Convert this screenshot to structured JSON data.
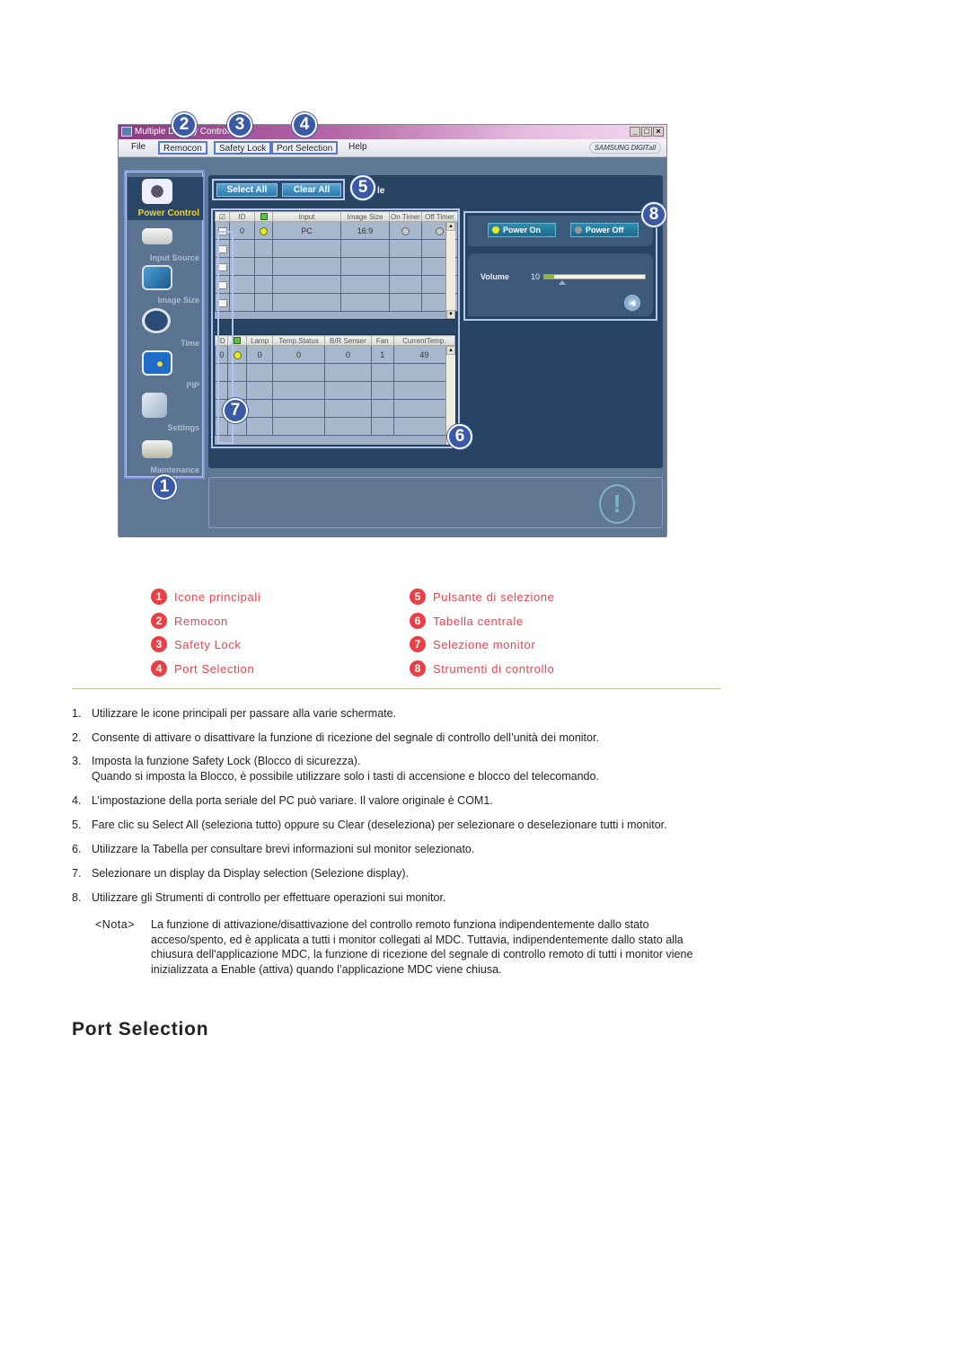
{
  "app": {
    "window_title": "Multiple Display Control",
    "window_buttons": [
      "_",
      "□",
      "×"
    ],
    "menu": [
      "File",
      "Remocon",
      "Safety Lock",
      "Port Selection",
      "Help"
    ],
    "brand": "SAMSUNG DIGITall",
    "sidebar": [
      {
        "label": "Power Control",
        "icon": "power-control-icon",
        "active": true
      },
      {
        "label": "Input Source",
        "icon": "input-source-icon",
        "active": false
      },
      {
        "label": "Image Size",
        "icon": "image-size-icon",
        "active": false
      },
      {
        "label": "Time",
        "icon": "clock-icon",
        "active": false
      },
      {
        "label": "PIP",
        "icon": "pip-icon",
        "active": false
      },
      {
        "label": "Settings",
        "icon": "settings-icon",
        "active": false
      },
      {
        "label": "Maintenance",
        "icon": "maintenance-icon",
        "active": false
      }
    ],
    "select_all": "Select All",
    "clear_all": "Clear All",
    "peek_text": "le",
    "top_table": {
      "headers": [
        "☑",
        "ID",
        "●",
        "Input",
        "Image Size",
        "On Timer",
        "Off Timer"
      ],
      "rows": [
        {
          "id": "0",
          "input": "PC",
          "image_size": "16:9"
        }
      ],
      "empty_rows": 4
    },
    "bottom_table": {
      "headers": [
        "ID",
        "●",
        "Lamp",
        "Temp.Status",
        "B/R Senser",
        "Fan",
        "CurrentTemp."
      ],
      "rows": [
        {
          "id": "0",
          "lamp": "0",
          "temp_status": "0",
          "br_senser": "0",
          "fan": "1",
          "current_temp": "49"
        }
      ],
      "empty_rows": 4
    },
    "power_on": "Power On",
    "power_off": "Power Off",
    "volume_label": "Volume",
    "volume_value": "10",
    "volume_fraction": 0.1,
    "warning_glyph": "!",
    "callouts": [
      "1",
      "2",
      "3",
      "4",
      "5",
      "6",
      "7",
      "8"
    ]
  },
  "legend": [
    {
      "num": "1",
      "label": "Icone principali"
    },
    {
      "num": "2",
      "label": "Remocon"
    },
    {
      "num": "3",
      "label": "Safety Lock"
    },
    {
      "num": "4",
      "label": "Port Selection"
    },
    {
      "num": "5",
      "label": "Pulsante di selezione"
    },
    {
      "num": "6",
      "label": "Tabella centrale"
    },
    {
      "num": "7",
      "label": "Selezione monitor"
    },
    {
      "num": "8",
      "label": "Strumenti di controllo"
    }
  ],
  "steps": [
    {
      "num": "1.",
      "text": "Utilizzare le icone principali per passare alla varie schermate."
    },
    {
      "num": "2.",
      "text": "Consente di attivare o disattivare la funzione di ricezione del segnale di controllo dell’unità dei monitor."
    },
    {
      "num": "3.",
      "text": "Imposta la funzione Safety Lock (Blocco di sicurezza).",
      "text2": "Quando si imposta la Blocco, è possibile utilizzare solo i tasti di accensione e blocco del telecomando."
    },
    {
      "num": "4.",
      "text": "L’impostazione della porta seriale del PC può variare. Il valore originale è COM1."
    },
    {
      "num": "5.",
      "text": "Fare clic su Select All (seleziona tutto) oppure su Clear (deseleziona) per selezionare o deselezionare tutti i monitor."
    },
    {
      "num": "6.",
      "text": "Utilizzare la Tabella per consultare brevi informazioni sul monitor selezionato."
    },
    {
      "num": "7.",
      "text": "Selezionare un display da Display selection (Selezione display)."
    },
    {
      "num": "8.",
      "text": "Utilizzare gli Strumenti di controllo per effettuare operazioni sui monitor."
    }
  ],
  "note": {
    "tag": "<Nota>",
    "text": "La funzione di attivazione/disattivazione del controllo remoto funziona indipendentemente dallo stato acceso/spento, ed è applicata a tutti i monitor collegati al MDC. Tuttavia, indipendentemente dallo stato alla chiusura dell'applicazione MDC, la funzione di ricezione del segnale di controllo remoto di tutti i monitor viene inizializzata a Enable (attiva) quando l’applicazione MDC viene chiusa."
  },
  "section_title": "Port Selection",
  "colors": {
    "legend_red": "#e34550",
    "callout_blue": "#3b5aa6",
    "app_panel": "#274562",
    "active_label": "#f4d21e"
  }
}
